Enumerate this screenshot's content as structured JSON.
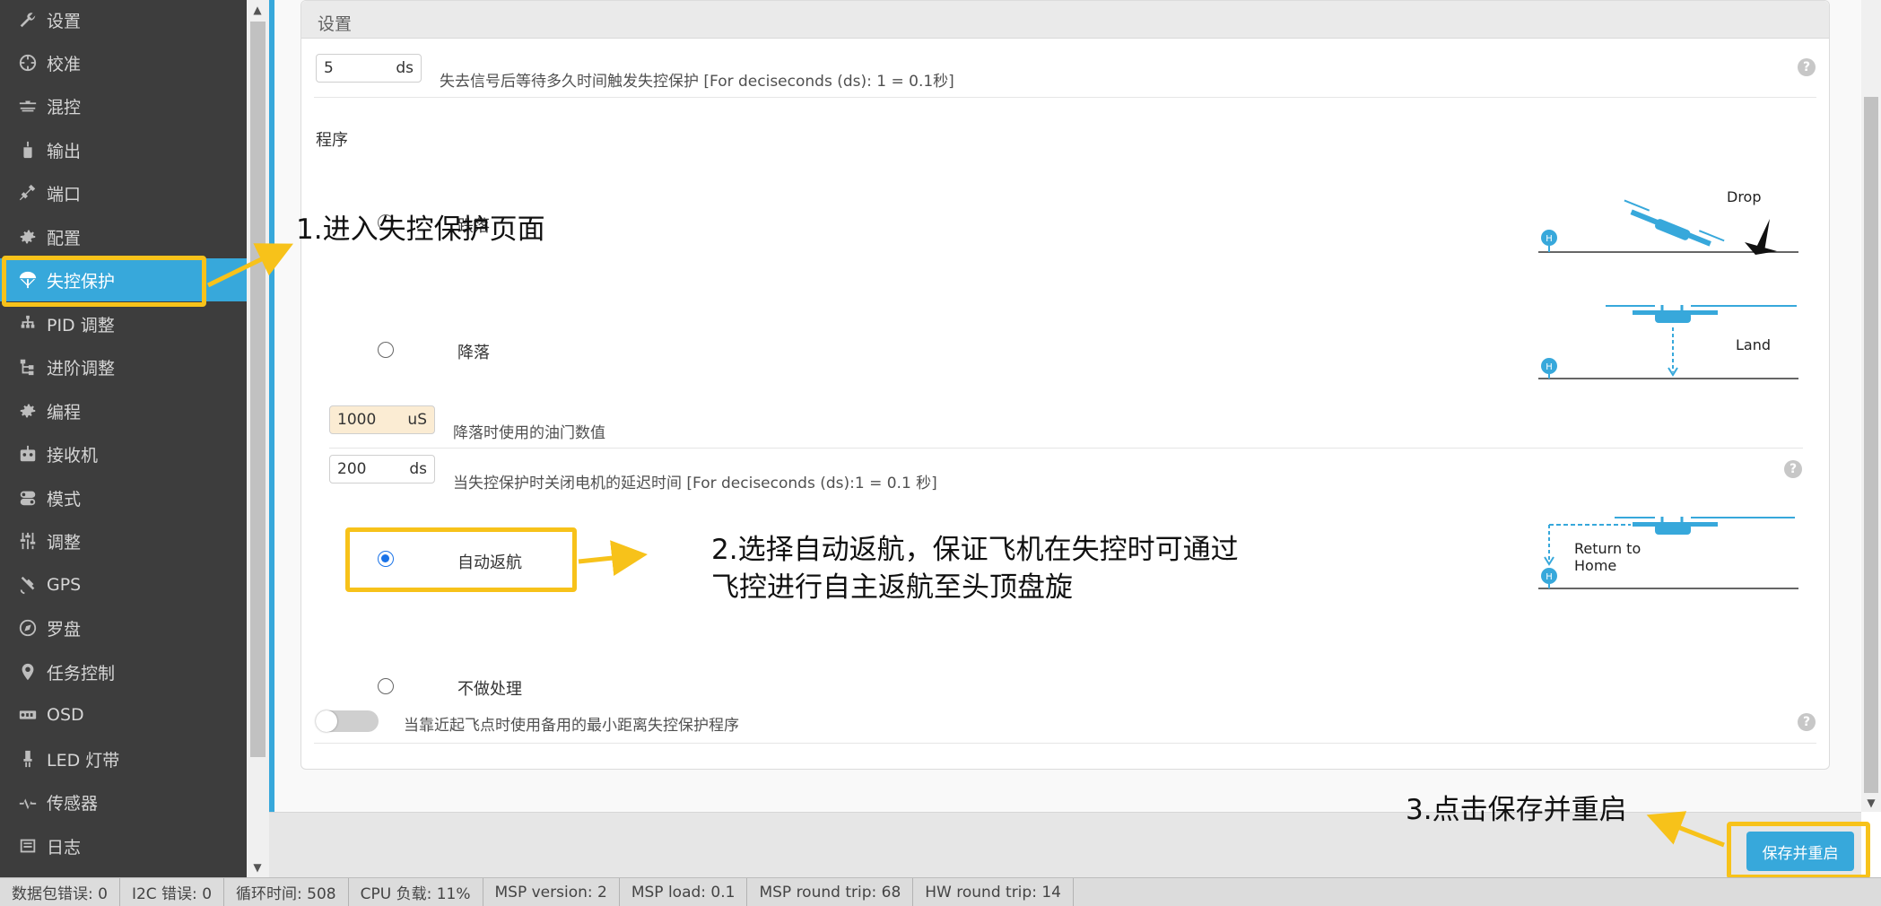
{
  "sidebar": {
    "items": [
      {
        "label": "设置",
        "icon": "wrench-icon"
      },
      {
        "label": "校准",
        "icon": "crosshair-icon"
      },
      {
        "label": "混控",
        "icon": "mixer-icon"
      },
      {
        "label": "输出",
        "icon": "motor-icon"
      },
      {
        "label": "端口",
        "icon": "plug-icon"
      },
      {
        "label": "配置",
        "icon": "gear-icon"
      },
      {
        "label": "失控保护",
        "icon": "parachute-icon"
      },
      {
        "label": "PID 调整",
        "icon": "hierarchy-icon"
      },
      {
        "label": "进阶调整",
        "icon": "tree-icon"
      },
      {
        "label": "编程",
        "icon": "gear-icon"
      },
      {
        "label": "接收机",
        "icon": "receiver-icon"
      },
      {
        "label": "模式",
        "icon": "toggle-icon"
      },
      {
        "label": "调整",
        "icon": "sliders-icon"
      },
      {
        "label": "GPS",
        "icon": "satellite-icon"
      },
      {
        "label": "罗盘",
        "icon": "compass-icon"
      },
      {
        "label": "任务控制",
        "icon": "map-pin-icon"
      },
      {
        "label": "OSD",
        "icon": "osd-icon"
      },
      {
        "label": "LED 灯带",
        "icon": "led-icon"
      },
      {
        "label": "传感器",
        "icon": "pulse-icon"
      },
      {
        "label": "日志",
        "icon": "log-icon"
      }
    ]
  },
  "panel": {
    "title": "设置",
    "delay": {
      "value": "5",
      "unit": "ds",
      "desc": "失去信号后等待多久时间触发失控保护 [For deciseconds (ds): 1 = 0.1秒]"
    },
    "procedure_title": "程序",
    "drop": {
      "label": "跌落",
      "illus_label": "Drop"
    },
    "land": {
      "label": "降落",
      "illus_label": "Land",
      "throttle": {
        "value": "1000",
        "unit": "uS",
        "desc": "降落时使用的油门数值"
      },
      "motor_delay": {
        "value": "200",
        "unit": "ds",
        "desc": "当失控保护时关闭电机的延迟时间 [For deciseconds (ds):1 = 0.1 秒]"
      }
    },
    "rth": {
      "label": "自动返航",
      "illus_line1": "Return to",
      "illus_line2": "Home"
    },
    "none": {
      "label": "不做处理"
    },
    "min_distance": {
      "desc": "当靠近起飞点时使用备用的最小距离失控保护程序"
    },
    "home_marker": "H",
    "help_glyph": "?"
  },
  "save_button": "保存并重启",
  "annotations": {
    "step1": "1.进入失控保护页面",
    "step2_line1": "2.选择自动返航，保证飞机在失控时可通过",
    "step2_line2": "飞控进行自主返航至头顶盘旋",
    "step3": "3.点击保存并重启"
  },
  "status_bar": [
    "数据包错误: 0",
    "I2C 错误: 0",
    "循环时间: 508",
    "CPU 负载: 11%",
    "MSP version: 2",
    "MSP load: 0.1",
    "MSP round trip: 68",
    "HW round trip: 14"
  ],
  "colors": {
    "accent": "#37a8db",
    "annotation": "#f7c21a",
    "sidebar": "#3d3d3d"
  }
}
